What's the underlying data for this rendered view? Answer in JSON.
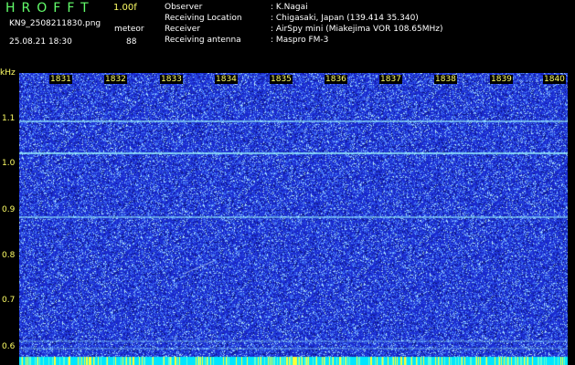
{
  "header": {
    "logo": "HROFFT",
    "version": "1.00f",
    "filename": "KN9_2508211830.png",
    "meteor_label": "meteor",
    "datetime": "25.08.21 18:30",
    "meteor_count": "88"
  },
  "info": {
    "rows": [
      {
        "label": "Observer",
        "value": ": K.Nagai"
      },
      {
        "label": "Receiving Location",
        "value": ": Chigasaki, Japan (139.414 35.340)"
      },
      {
        "label": "Receiver",
        "value": ": AirSpy mini (Miakejima VOR 108.65MHz)"
      },
      {
        "label": "Receiving antenna",
        "value": ": Maspro FM-3"
      }
    ]
  },
  "spectrogram": {
    "y_unit": "kHz",
    "y_ticks": [
      "1.1",
      "1.0",
      "0.9",
      "0.8",
      "0.7",
      "0.6"
    ],
    "x_ticks": [
      "1831",
      "1832",
      "1833",
      "1834",
      "1835",
      "1836",
      "1837",
      "1838",
      "1839",
      "1840"
    ],
    "colors": {
      "background": "#1a2ad0",
      "noise": "#7fb0ff",
      "carrier": "#9effff",
      "bottom_bar": "#00e5ff"
    }
  }
}
